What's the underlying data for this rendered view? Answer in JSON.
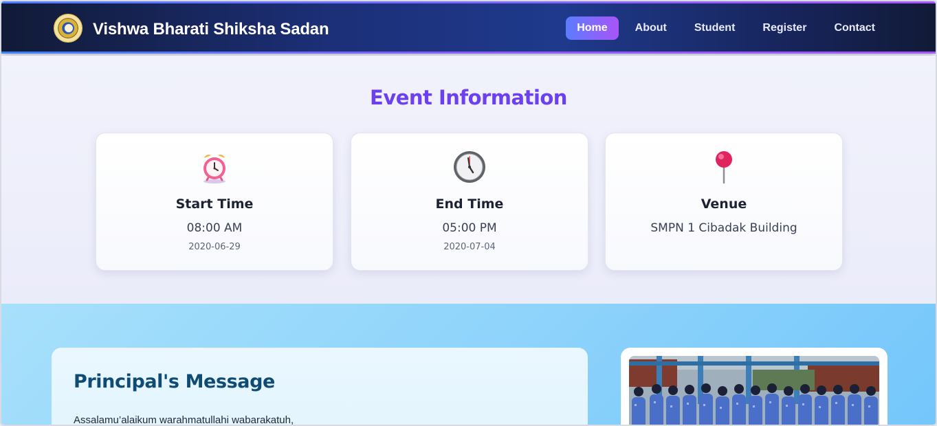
{
  "navbar": {
    "brand": "Vishwa Bharati Shiksha Sadan",
    "links": [
      {
        "label": "Home",
        "active": true
      },
      {
        "label": "About",
        "active": false
      },
      {
        "label": "Student",
        "active": false
      },
      {
        "label": "Register",
        "active": false
      },
      {
        "label": "Contact",
        "active": false
      }
    ]
  },
  "event": {
    "title": "Event Information",
    "cards": [
      {
        "icon": "alarm-clock-icon",
        "label": "Start Time",
        "value": "08:00 AM",
        "date": "2020-06-29"
      },
      {
        "icon": "clock-icon",
        "label": "End Time",
        "value": "05:00 PM",
        "date": "2020-07-04"
      },
      {
        "icon": "pushpin-icon",
        "label": "Venue",
        "value": "SMPN 1 Cibadak Building",
        "date": ""
      }
    ]
  },
  "principal": {
    "title": "Principal's Message",
    "text": "Assalamu’alaikum warahmatullahi wabarakatuh,"
  },
  "colors": {
    "accent": "#6c3ff0",
    "nav_active_start": "#5b7cff",
    "nav_active_end": "#a855f7",
    "principal_title": "#0f4c75"
  }
}
